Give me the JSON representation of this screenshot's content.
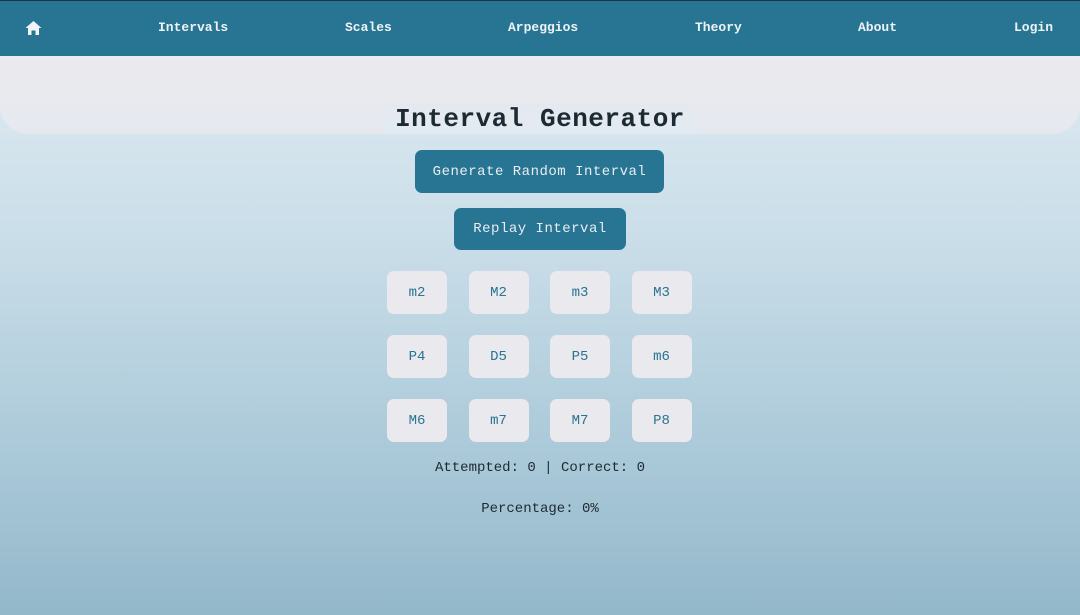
{
  "nav": {
    "home_icon": "home-icon",
    "items": [
      {
        "label": "Intervals"
      },
      {
        "label": "Scales"
      },
      {
        "label": "Arpeggios"
      },
      {
        "label": "Theory"
      },
      {
        "label": "About"
      },
      {
        "label": "Login"
      }
    ]
  },
  "main": {
    "title": "Interval Generator",
    "generate_label": "Generate Random Interval",
    "replay_label": "Replay Interval",
    "intervals": [
      "m2",
      "M2",
      "m3",
      "M3",
      "P4",
      "D5",
      "P5",
      "m6",
      "M6",
      "m7",
      "M7",
      "P8"
    ],
    "stats_text": "Attempted: 0 | Correct: 0",
    "percentage_text": "Percentage: 0%"
  },
  "colors": {
    "primary": "#287493",
    "button_light": "#e9e9ee",
    "text_dark": "#1e2a33"
  }
}
